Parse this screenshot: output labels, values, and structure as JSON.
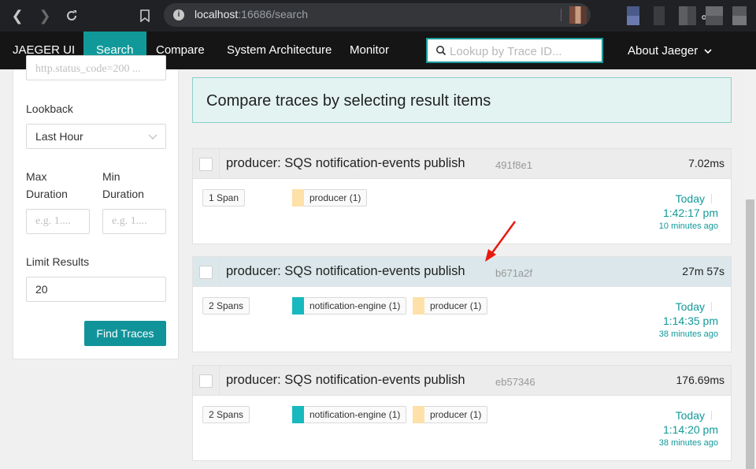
{
  "browser": {
    "url_host": "localhost",
    "url_rest": ":16686/search"
  },
  "topnav": {
    "brand": "JAEGER UI",
    "items": [
      {
        "label": "Search",
        "active": true
      },
      {
        "label": "Compare",
        "active": false
      },
      {
        "label": "System Architecture",
        "active": false
      },
      {
        "label": "Monitor",
        "active": false
      }
    ],
    "lookup_placeholder": "Lookup by Trace ID...",
    "about": "About Jaeger"
  },
  "sidebar": {
    "tags_placeholder": "http.status_code=200 ...",
    "lookback_label": "Lookback",
    "lookback_value": "Last Hour",
    "max_duration_label": "Max Duration",
    "min_duration_label": "Min Duration",
    "max_placeholder": "e.g. 1....",
    "min_placeholder": "e.g. 1....",
    "limit_label": "Limit Results",
    "limit_value": "20",
    "find_button": "Find Traces"
  },
  "compare_banner": "Compare traces by selecting result items",
  "traces": [
    {
      "title": "producer: SQS notification-events publish",
      "trace_id": "491f8e1",
      "duration": "7.02ms",
      "spans": "1 Span",
      "services": [
        {
          "name": "producer (1)",
          "color": "#fde1a8"
        }
      ],
      "day": "Today",
      "time": "1:42:17 pm",
      "ago": "10 minutes ago"
    },
    {
      "title": "producer: SQS notification-events publish",
      "trace_id": "b671a2f",
      "duration": "27m 57s",
      "spans": "2 Spans",
      "services": [
        {
          "name": "notification-engine (1)",
          "color": "#17b8be"
        },
        {
          "name": "producer (1)",
          "color": "#fde1a8"
        }
      ],
      "day": "Today",
      "time": "1:14:35 pm",
      "ago": "38 minutes ago"
    },
    {
      "title": "producer: SQS notification-events publish",
      "trace_id": "eb57346",
      "duration": "176.69ms",
      "spans": "2 Spans",
      "services": [
        {
          "name": "notification-engine (1)",
          "color": "#17b8be"
        },
        {
          "name": "producer (1)",
          "color": "#fde1a8"
        }
      ],
      "day": "Today",
      "time": "1:14:20 pm",
      "ago": "38 minutes ago"
    }
  ],
  "colors": {
    "accent": "#119999",
    "annotation_arrow": "#e8190f"
  }
}
